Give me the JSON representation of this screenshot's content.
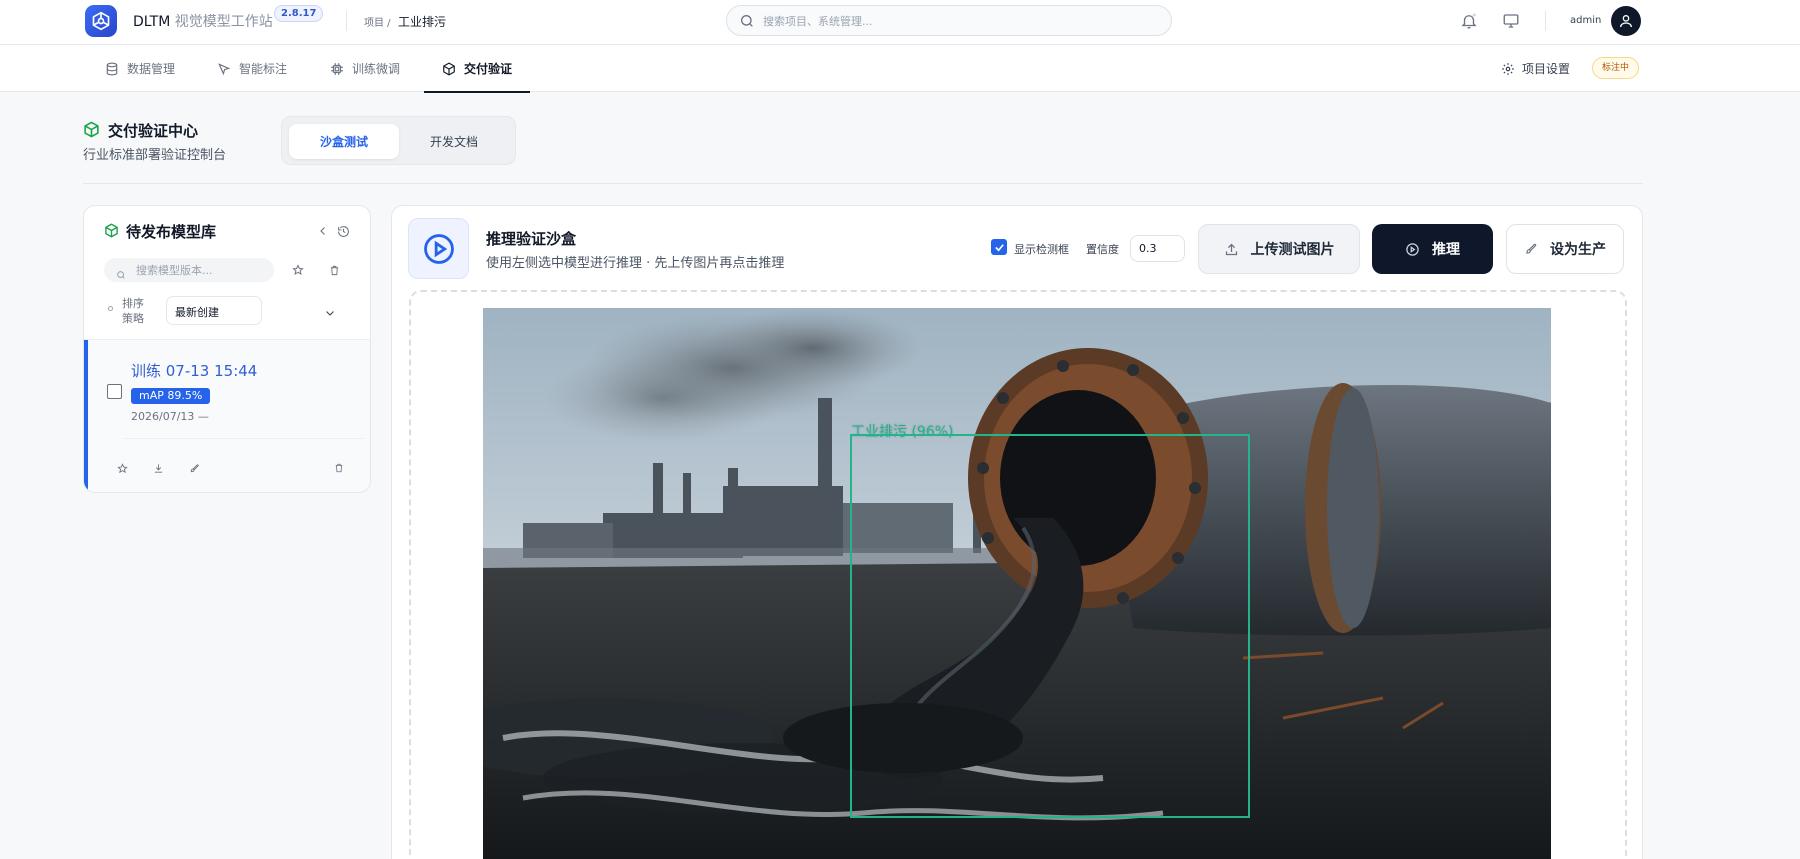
{
  "app": {
    "brand": "DLTM",
    "subtitle": "视觉模型工作站",
    "version": "2.8.17"
  },
  "breadcrumb": {
    "prefix": "项目 /",
    "current": "工业排污"
  },
  "search": {
    "placeholder": "搜索项目、系统管理..."
  },
  "user": {
    "name": "admin"
  },
  "nav": {
    "tabs": [
      {
        "label": "数据管理",
        "icon": "database-icon"
      },
      {
        "label": "智能标注",
        "icon": "cursor-icon"
      },
      {
        "label": "训练微调",
        "icon": "cpu-icon"
      },
      {
        "label": "交付验证",
        "icon": "box-icon",
        "active": true
      }
    ],
    "settings_label": "项目设置",
    "status_label": "标注中"
  },
  "page": {
    "title": "交付验证中心",
    "subtitle": "行业标准部署验证控制台",
    "segments": [
      "沙盒测试",
      "开发文档"
    ],
    "active_segment": "沙盒测试"
  },
  "library": {
    "title": "待发布模型库",
    "search_placeholder": "搜索模型版本...",
    "sort_label": "排序策略",
    "sort_value": "最新创建",
    "items": [
      {
        "name": "训练 07-13 15:44",
        "badge": "mAP 89.5%",
        "date": "2026/07/13",
        "extra": "—"
      }
    ]
  },
  "sandbox": {
    "title": "推理验证沙盒",
    "subtitle": "使用左侧选中模型进行推理 · 先上传图片再点击推理",
    "show_boxes_label": "显示检测框",
    "show_boxes": true,
    "confidence_label": "置信度",
    "confidence_value": "0.3",
    "upload_label": "上传测试图片",
    "infer_label": "推理",
    "promote_label": "设为生产"
  },
  "detection": {
    "label": "工业排污 (96%)",
    "color": "#22b58a"
  },
  "colors": {
    "accent": "#2563eb",
    "dark": "#0f172a",
    "detection": "#22b58a"
  }
}
